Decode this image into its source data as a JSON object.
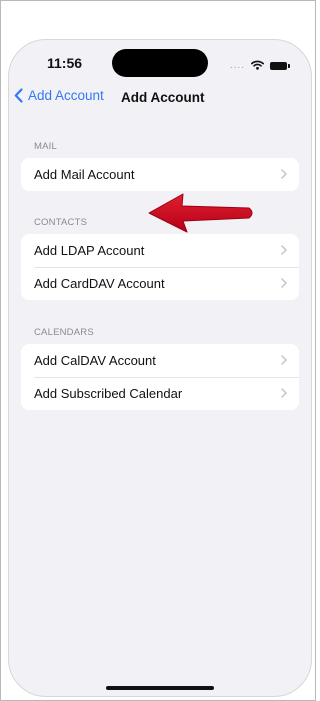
{
  "status_bar": {
    "time": "11:56",
    "signal_dots": "....",
    "icons": [
      "wifi-icon",
      "battery-icon"
    ]
  },
  "nav": {
    "back_label": "Add Account",
    "title": "Add Account",
    "accent_color": "#3478f6"
  },
  "sections": [
    {
      "header": "MAIL",
      "items": [
        {
          "label": "Add Mail Account"
        }
      ]
    },
    {
      "header": "CONTACTS",
      "items": [
        {
          "label": "Add LDAP Account"
        },
        {
          "label": "Add CardDAV Account"
        }
      ]
    },
    {
      "header": "CALENDARS",
      "items": [
        {
          "label": "Add CalDAV Account"
        },
        {
          "label": "Add Subscribed Calendar"
        }
      ]
    }
  ],
  "annotation": {
    "type": "arrow-icon",
    "color": "#d0021b"
  }
}
